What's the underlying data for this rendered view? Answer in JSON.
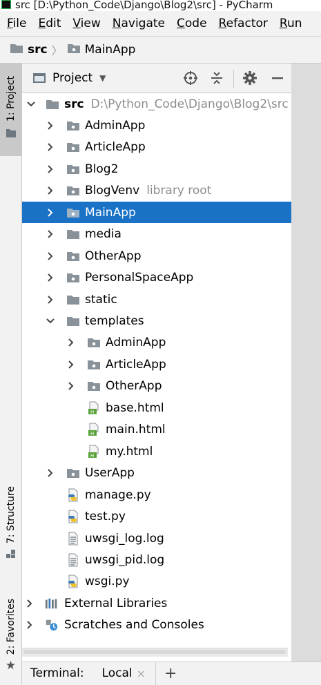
{
  "window": {
    "title": "src [D:\\Python_Code\\Django\\Blog2\\src] - PyCharm"
  },
  "menu": [
    {
      "label": "File",
      "mn": "F",
      "rest": "ile"
    },
    {
      "label": "Edit",
      "mn": "E",
      "rest": "dit"
    },
    {
      "label": "View",
      "mn": "V",
      "rest": "iew"
    },
    {
      "label": "Navigate",
      "mn": "N",
      "rest": "avigate"
    },
    {
      "label": "Code",
      "mn": "C",
      "rest": "ode"
    },
    {
      "label": "Refactor",
      "mn": "R",
      "rest": "efactor"
    },
    {
      "label": "Run",
      "mn": "R",
      "rest": "un"
    }
  ],
  "breadcrumb": {
    "root": "src",
    "child": "MainApp"
  },
  "left_tabs": {
    "project": "1: Project",
    "structure": "7: Structure",
    "favorites": "2: Favorites"
  },
  "panel": {
    "title": "Project"
  },
  "tree": [
    {
      "label": "src",
      "hint": "D:\\Python_Code\\Django\\Blog2\\src",
      "type": "root-folder",
      "arrow": "down",
      "level": 0,
      "bold": true
    },
    {
      "label": "AdminApp",
      "type": "pkg",
      "arrow": "right",
      "level": 1
    },
    {
      "label": "ArticleApp",
      "type": "pkg",
      "arrow": "right",
      "level": 1
    },
    {
      "label": "Blog2",
      "type": "pkg",
      "arrow": "right",
      "level": 1
    },
    {
      "label": "BlogVenv",
      "hint": "library root",
      "type": "pkg",
      "arrow": "right",
      "level": 1
    },
    {
      "label": "MainApp",
      "type": "pkg",
      "arrow": "right",
      "level": 1,
      "selected": true
    },
    {
      "label": "media",
      "type": "folder",
      "arrow": "right",
      "level": 1
    },
    {
      "label": "OtherApp",
      "type": "pkg",
      "arrow": "right",
      "level": 1
    },
    {
      "label": "PersonalSpaceApp",
      "type": "pkg",
      "arrow": "right",
      "level": 1
    },
    {
      "label": "static",
      "type": "folder",
      "arrow": "right",
      "level": 1
    },
    {
      "label": "templates",
      "type": "folder",
      "arrow": "down",
      "level": 1
    },
    {
      "label": "AdminApp",
      "type": "pkg",
      "arrow": "right",
      "level": 2
    },
    {
      "label": "ArticleApp",
      "type": "pkg",
      "arrow": "right",
      "level": 2
    },
    {
      "label": "OtherApp",
      "type": "pkg",
      "arrow": "right",
      "level": 2
    },
    {
      "label": "base.html",
      "type": "html",
      "level": 2
    },
    {
      "label": "main.html",
      "type": "html",
      "level": 2
    },
    {
      "label": "my.html",
      "type": "html",
      "level": 2
    },
    {
      "label": "UserApp",
      "type": "pkg",
      "arrow": "right",
      "level": 1
    },
    {
      "label": "manage.py",
      "type": "py",
      "level": 1
    },
    {
      "label": "test.py",
      "type": "py",
      "level": 1
    },
    {
      "label": "uwsgi_log.log",
      "type": "log",
      "level": 1
    },
    {
      "label": "uwsgi_pid.log",
      "type": "log",
      "level": 1
    },
    {
      "label": "wsgi.py",
      "type": "py",
      "level": 1
    },
    {
      "label": "External Libraries",
      "type": "libs",
      "arrow": "right",
      "level": 0
    },
    {
      "label": "Scratches and Consoles",
      "type": "scratch",
      "arrow": "right",
      "level": 0
    }
  ],
  "terminal": {
    "label": "Terminal:",
    "tab": "Local",
    "close": "×",
    "add": "+"
  },
  "colors": {
    "selection": "#1a72c6",
    "folder": "#8a9299",
    "html_green": "#5aa33a",
    "py_blue": "#3d7ab8",
    "py_yellow": "#f2c12e"
  }
}
